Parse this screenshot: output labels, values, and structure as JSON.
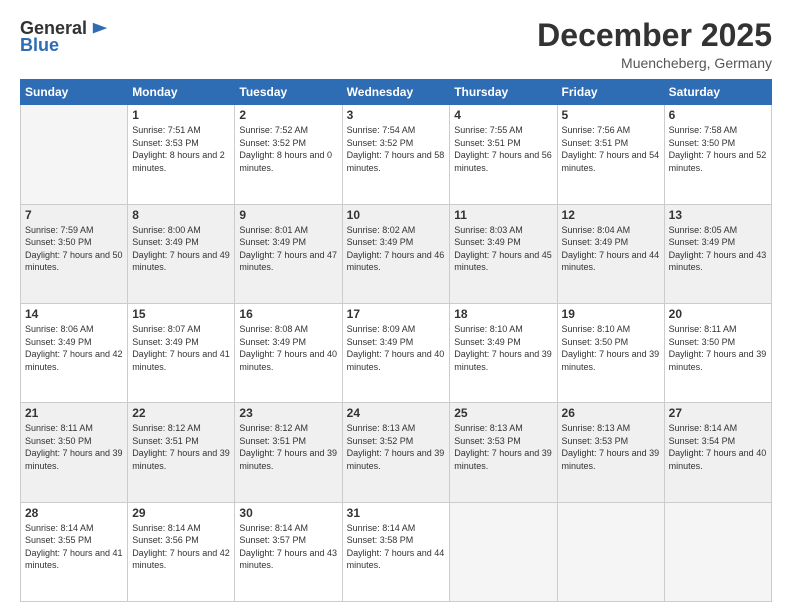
{
  "header": {
    "logo_general": "General",
    "logo_blue": "Blue",
    "month_title": "December 2025",
    "location": "Muencheberg, Germany"
  },
  "days_of_week": [
    "Sunday",
    "Monday",
    "Tuesday",
    "Wednesday",
    "Thursday",
    "Friday",
    "Saturday"
  ],
  "weeks": [
    {
      "shaded": false,
      "days": [
        {
          "num": "",
          "sunrise": "",
          "sunset": "",
          "daylight": "",
          "empty": true
        },
        {
          "num": "1",
          "sunrise": "Sunrise: 7:51 AM",
          "sunset": "Sunset: 3:53 PM",
          "daylight": "Daylight: 8 hours and 2 minutes."
        },
        {
          "num": "2",
          "sunrise": "Sunrise: 7:52 AM",
          "sunset": "Sunset: 3:52 PM",
          "daylight": "Daylight: 8 hours and 0 minutes."
        },
        {
          "num": "3",
          "sunrise": "Sunrise: 7:54 AM",
          "sunset": "Sunset: 3:52 PM",
          "daylight": "Daylight: 7 hours and 58 minutes."
        },
        {
          "num": "4",
          "sunrise": "Sunrise: 7:55 AM",
          "sunset": "Sunset: 3:51 PM",
          "daylight": "Daylight: 7 hours and 56 minutes."
        },
        {
          "num": "5",
          "sunrise": "Sunrise: 7:56 AM",
          "sunset": "Sunset: 3:51 PM",
          "daylight": "Daylight: 7 hours and 54 minutes."
        },
        {
          "num": "6",
          "sunrise": "Sunrise: 7:58 AM",
          "sunset": "Sunset: 3:50 PM",
          "daylight": "Daylight: 7 hours and 52 minutes."
        }
      ]
    },
    {
      "shaded": true,
      "days": [
        {
          "num": "7",
          "sunrise": "Sunrise: 7:59 AM",
          "sunset": "Sunset: 3:50 PM",
          "daylight": "Daylight: 7 hours and 50 minutes."
        },
        {
          "num": "8",
          "sunrise": "Sunrise: 8:00 AM",
          "sunset": "Sunset: 3:49 PM",
          "daylight": "Daylight: 7 hours and 49 minutes."
        },
        {
          "num": "9",
          "sunrise": "Sunrise: 8:01 AM",
          "sunset": "Sunset: 3:49 PM",
          "daylight": "Daylight: 7 hours and 47 minutes."
        },
        {
          "num": "10",
          "sunrise": "Sunrise: 8:02 AM",
          "sunset": "Sunset: 3:49 PM",
          "daylight": "Daylight: 7 hours and 46 minutes."
        },
        {
          "num": "11",
          "sunrise": "Sunrise: 8:03 AM",
          "sunset": "Sunset: 3:49 PM",
          "daylight": "Daylight: 7 hours and 45 minutes."
        },
        {
          "num": "12",
          "sunrise": "Sunrise: 8:04 AM",
          "sunset": "Sunset: 3:49 PM",
          "daylight": "Daylight: 7 hours and 44 minutes."
        },
        {
          "num": "13",
          "sunrise": "Sunrise: 8:05 AM",
          "sunset": "Sunset: 3:49 PM",
          "daylight": "Daylight: 7 hours and 43 minutes."
        }
      ]
    },
    {
      "shaded": false,
      "days": [
        {
          "num": "14",
          "sunrise": "Sunrise: 8:06 AM",
          "sunset": "Sunset: 3:49 PM",
          "daylight": "Daylight: 7 hours and 42 minutes."
        },
        {
          "num": "15",
          "sunrise": "Sunrise: 8:07 AM",
          "sunset": "Sunset: 3:49 PM",
          "daylight": "Daylight: 7 hours and 41 minutes."
        },
        {
          "num": "16",
          "sunrise": "Sunrise: 8:08 AM",
          "sunset": "Sunset: 3:49 PM",
          "daylight": "Daylight: 7 hours and 40 minutes."
        },
        {
          "num": "17",
          "sunrise": "Sunrise: 8:09 AM",
          "sunset": "Sunset: 3:49 PM",
          "daylight": "Daylight: 7 hours and 40 minutes."
        },
        {
          "num": "18",
          "sunrise": "Sunrise: 8:10 AM",
          "sunset": "Sunset: 3:49 PM",
          "daylight": "Daylight: 7 hours and 39 minutes."
        },
        {
          "num": "19",
          "sunrise": "Sunrise: 8:10 AM",
          "sunset": "Sunset: 3:50 PM",
          "daylight": "Daylight: 7 hours and 39 minutes."
        },
        {
          "num": "20",
          "sunrise": "Sunrise: 8:11 AM",
          "sunset": "Sunset: 3:50 PM",
          "daylight": "Daylight: 7 hours and 39 minutes."
        }
      ]
    },
    {
      "shaded": true,
      "days": [
        {
          "num": "21",
          "sunrise": "Sunrise: 8:11 AM",
          "sunset": "Sunset: 3:50 PM",
          "daylight": "Daylight: 7 hours and 39 minutes."
        },
        {
          "num": "22",
          "sunrise": "Sunrise: 8:12 AM",
          "sunset": "Sunset: 3:51 PM",
          "daylight": "Daylight: 7 hours and 39 minutes."
        },
        {
          "num": "23",
          "sunrise": "Sunrise: 8:12 AM",
          "sunset": "Sunset: 3:51 PM",
          "daylight": "Daylight: 7 hours and 39 minutes."
        },
        {
          "num": "24",
          "sunrise": "Sunrise: 8:13 AM",
          "sunset": "Sunset: 3:52 PM",
          "daylight": "Daylight: 7 hours and 39 minutes."
        },
        {
          "num": "25",
          "sunrise": "Sunrise: 8:13 AM",
          "sunset": "Sunset: 3:53 PM",
          "daylight": "Daylight: 7 hours and 39 minutes."
        },
        {
          "num": "26",
          "sunrise": "Sunrise: 8:13 AM",
          "sunset": "Sunset: 3:53 PM",
          "daylight": "Daylight: 7 hours and 39 minutes."
        },
        {
          "num": "27",
          "sunrise": "Sunrise: 8:14 AM",
          "sunset": "Sunset: 3:54 PM",
          "daylight": "Daylight: 7 hours and 40 minutes."
        }
      ]
    },
    {
      "shaded": false,
      "days": [
        {
          "num": "28",
          "sunrise": "Sunrise: 8:14 AM",
          "sunset": "Sunset: 3:55 PM",
          "daylight": "Daylight: 7 hours and 41 minutes."
        },
        {
          "num": "29",
          "sunrise": "Sunrise: 8:14 AM",
          "sunset": "Sunset: 3:56 PM",
          "daylight": "Daylight: 7 hours and 42 minutes."
        },
        {
          "num": "30",
          "sunrise": "Sunrise: 8:14 AM",
          "sunset": "Sunset: 3:57 PM",
          "daylight": "Daylight: 7 hours and 43 minutes."
        },
        {
          "num": "31",
          "sunrise": "Sunrise: 8:14 AM",
          "sunset": "Sunset: 3:58 PM",
          "daylight": "Daylight: 7 hours and 44 minutes."
        },
        {
          "num": "",
          "sunrise": "",
          "sunset": "",
          "daylight": "",
          "empty": true
        },
        {
          "num": "",
          "sunrise": "",
          "sunset": "",
          "daylight": "",
          "empty": true
        },
        {
          "num": "",
          "sunrise": "",
          "sunset": "",
          "daylight": "",
          "empty": true
        }
      ]
    }
  ]
}
